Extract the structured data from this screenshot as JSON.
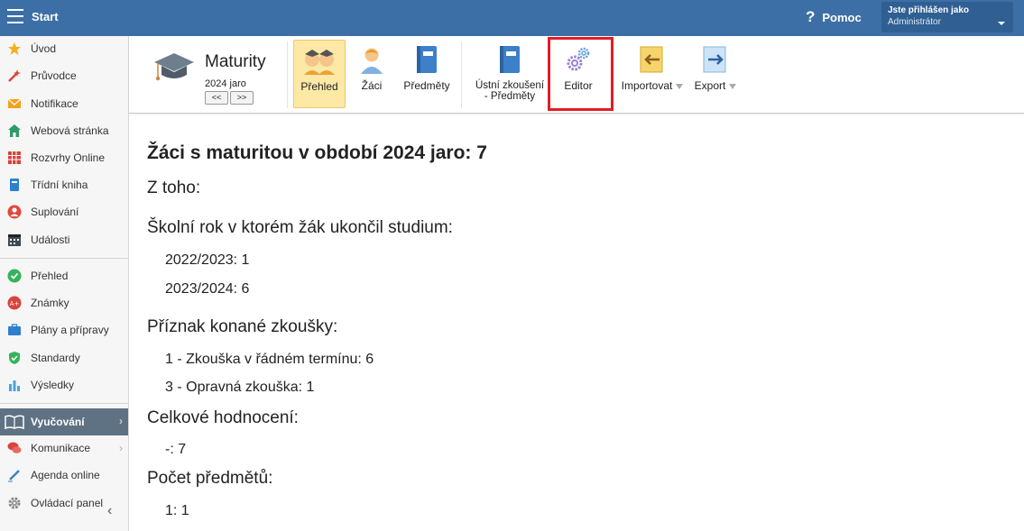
{
  "topbar": {
    "title": "Start",
    "help_label": "Pomoc",
    "user": {
      "caption": "Jste přihlášen jako",
      "role": "Administrátor"
    }
  },
  "sidebar": {
    "items": [
      {
        "label": "Úvod",
        "icon": "star-icon"
      },
      {
        "label": "Průvodce",
        "icon": "wand-icon"
      },
      {
        "label": "Notifikace",
        "icon": "envelope-icon"
      },
      {
        "label": "Webová stránka",
        "icon": "home-icon"
      },
      {
        "label": "Rozvrhy Online",
        "icon": "calendar-grid-icon"
      },
      {
        "label": "Třídní kniha",
        "icon": "book-icon"
      },
      {
        "label": "Suplování",
        "icon": "person-icon"
      },
      {
        "label": "Události",
        "icon": "calendar-icon"
      },
      {
        "label": "Přehled",
        "icon": "check-circle-icon"
      },
      {
        "label": "Známky",
        "icon": "grade-icon"
      },
      {
        "label": "Plány a přípravy",
        "icon": "briefcase-icon"
      },
      {
        "label": "Standardy",
        "icon": "shield-icon"
      },
      {
        "label": "Výsledky",
        "icon": "bar-chart-icon"
      },
      {
        "label": "Vyučování",
        "icon": "open-book-icon"
      },
      {
        "label": "Komunikace",
        "icon": "chat-icon"
      },
      {
        "label": "Agenda online",
        "icon": "pen-icon"
      },
      {
        "label": "Ovládací panel",
        "icon": "gear-icon"
      }
    ]
  },
  "toolbar": {
    "module_title": "Maturity",
    "period": "2024 jaro",
    "prev_label": "<<",
    "next_label": ">>",
    "buttons": {
      "prehled": "Přehled",
      "zaci": "Žáci",
      "predmety": "Předměty",
      "ustni_l1": "Ústní zkoušení",
      "ustni_l2": "- Předměty",
      "editor": "Editor",
      "importovat": "Importovat",
      "export": "Export"
    }
  },
  "main": {
    "heading": "Žáci s maturitou v období 2024 jaro: 7",
    "subheading": "Z toho:",
    "sections": [
      {
        "title": "Školní rok v ktorém žák ukončil studium:",
        "items": [
          "2022/2023: 1",
          "2023/2024: 6"
        ]
      },
      {
        "title": "Příznak konané zkoušky:",
        "items": [
          "1 - Zkouška v řádném termínu: 6",
          "3 - Opravná zkouška: 1"
        ]
      },
      {
        "title": "Celkové hodnocení:",
        "items": [
          "-: 7"
        ]
      },
      {
        "title": "Počet předmětů:",
        "items": [
          "1: 1"
        ]
      }
    ]
  },
  "colors": {
    "topbar": "#3c6fa5",
    "active_sidebar": "#5f7283",
    "active_tool": "#fde8a6",
    "highlight": "#e01e25"
  }
}
